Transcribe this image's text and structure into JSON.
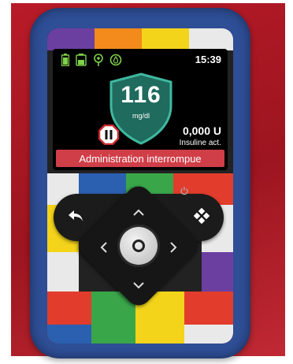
{
  "screen": {
    "time": "15:39",
    "glucose_value": "116",
    "glucose_unit": "mg/dl",
    "active_insulin_value": "0,000 U",
    "active_insulin_label": "Insuline act.",
    "alert_banner": "Administration interrompue"
  },
  "status_icons": [
    "battery-icon",
    "reservoir-icon",
    "connection-icon",
    "sensor-icon"
  ],
  "buttons": [
    "back-button",
    "menu-button",
    "up-button",
    "down-button",
    "left-button",
    "right-button",
    "select-button"
  ],
  "colors": {
    "glucose_shield": "#2f8d7a",
    "alert_banner": "#d03e48",
    "pause_icon": "#cc2b2b",
    "status_icons": "#7fd14a",
    "device_case": "#2e4e96"
  }
}
